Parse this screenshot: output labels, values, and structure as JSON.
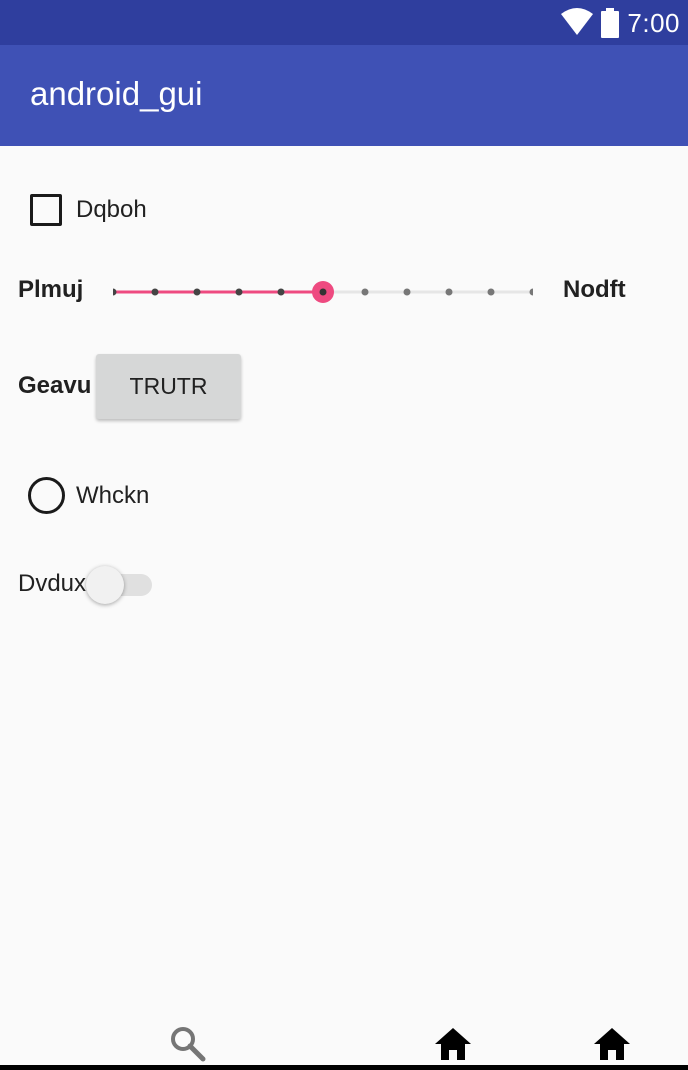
{
  "status_bar": {
    "time": "7:00",
    "icons": [
      "wifi-icon",
      "battery-icon"
    ]
  },
  "app_bar": {
    "title": "android_gui"
  },
  "checkbox": {
    "label": "Dqboh",
    "checked": false
  },
  "seekbar": {
    "left_label": "Plmuj",
    "right_label": "Nodft",
    "steps": 10,
    "value": 5,
    "accent": "#ee4a80"
  },
  "button_row": {
    "label": "Geavu",
    "button_label": "TRUTR"
  },
  "radio": {
    "label": "Whckn",
    "checked": false
  },
  "switch": {
    "label": "Dvdux",
    "on": false
  },
  "bottom_nav": {
    "items": [
      "search-icon",
      "home-icon",
      "home-icon"
    ]
  },
  "colors": {
    "status_bar": "#2f3e9e",
    "app_bar": "#3f51b5",
    "background": "#fafafa"
  }
}
